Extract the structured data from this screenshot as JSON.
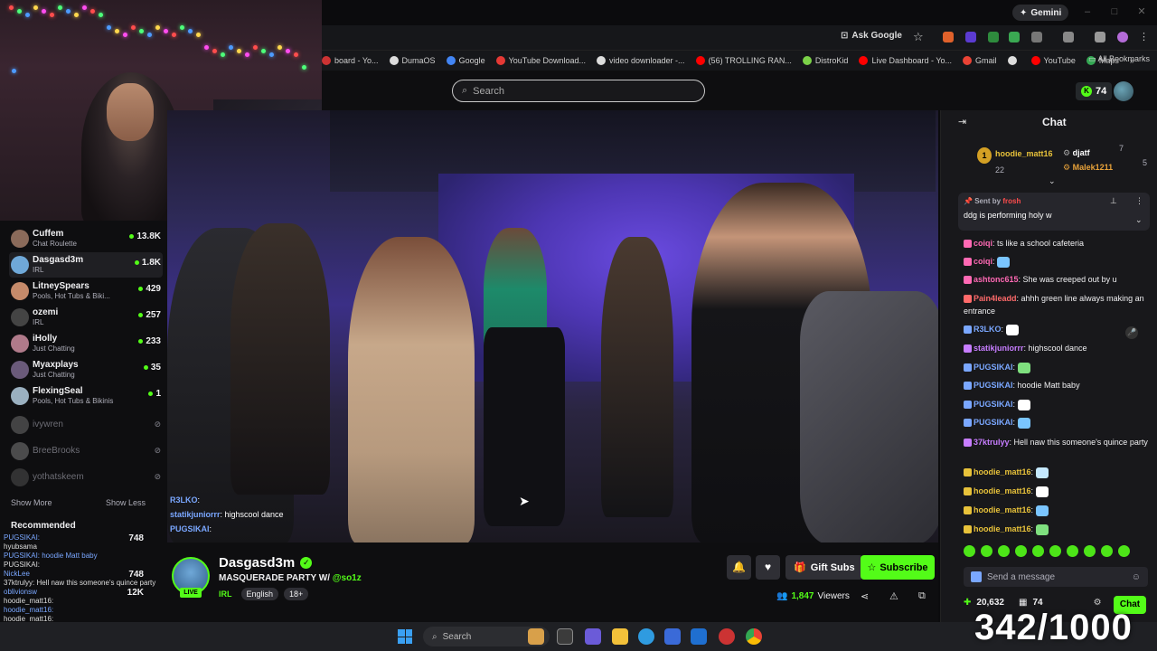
{
  "browser": {
    "gemini_label": "Gemini",
    "ask_google": "Ask Google",
    "bookmarks": [
      {
        "label": "board - Yo...",
        "color": "#cc3333"
      },
      {
        "label": "DumaOS",
        "color": "#dddddd"
      },
      {
        "label": "Google",
        "color": "#4285f4"
      },
      {
        "label": "YouTube Download...",
        "color": "#e53935"
      },
      {
        "label": "video downloader -...",
        "color": "#dddddd"
      },
      {
        "label": "(56) TROLLING RAN...",
        "color": "#ff0000"
      },
      {
        "label": "DistroKid",
        "color": "#7bd148"
      },
      {
        "label": "Live Dashboard - Yo...",
        "color": "#ff0000"
      },
      {
        "label": "Gmail",
        "color": "#ea4335"
      },
      {
        "label": "",
        "color": "#dddddd"
      },
      {
        "label": "YouTube",
        "color": "#ff0000"
      },
      {
        "label": "Maps",
        "color": "#34a853"
      }
    ],
    "all_bookmarks": "All Bookmarks"
  },
  "header": {
    "search_placeholder": "Search",
    "k_count": "74"
  },
  "sidebar": {
    "channels": [
      {
        "name": "Cuffem",
        "category": "Chat Roulette",
        "viewers": "13.8K",
        "color": "#8a6a5a"
      },
      {
        "name": "Dasgasd3m",
        "category": "IRL",
        "viewers": "1.8K",
        "color": "#6fa8d8"
      },
      {
        "name": "LitneySpears",
        "category": "Pools, Hot Tubs & Biki...",
        "viewers": "429",
        "color": "#c58a6a"
      },
      {
        "name": "ozemi",
        "category": "IRL",
        "viewers": "257",
        "color": "#444444"
      },
      {
        "name": "iHolly",
        "category": "Just Chatting",
        "viewers": "233",
        "color": "#b07a8a"
      },
      {
        "name": "Myaxplays",
        "category": "Just Chatting",
        "viewers": "35",
        "color": "#6a5a7a"
      },
      {
        "name": "FlexingSeal",
        "category": "Pools, Hot Tubs & Bikinis",
        "viewers": "1",
        "color": "#9ab0c0"
      }
    ],
    "offline": [
      {
        "name": "ivywren",
        "color": "#777777"
      },
      {
        "name": "BreeBrooks",
        "color": "#888888"
      },
      {
        "name": "yothatskeem",
        "color": "#555555"
      }
    ],
    "show_more": "Show More",
    "show_less": "Show Less",
    "recommended": "Recommended",
    "recommended_overlay": [
      {
        "text": "PUGSIKAI:",
        "value": "748"
      },
      {
        "text": "hyubsama",
        "value": ""
      },
      {
        "text": "PUGSIKAI: hoodie Matt baby",
        "value": ""
      },
      {
        "text": "PUGSIKAI:",
        "value": ""
      },
      {
        "text": "NickLee",
        "value": "748"
      },
      {
        "text": "37ktrulyy: Hell naw this someone's quince party",
        "value": ""
      },
      {
        "text": "oblivionsw",
        "value": "12K"
      },
      {
        "text": "hoodie_matt16:",
        "value": ""
      },
      {
        "text": "hoodie_matt16:",
        "value": ""
      },
      {
        "text": "hoodie_matt16:",
        "value": ""
      }
    ]
  },
  "video_overlay_chat": [
    {
      "user": "R3LKO",
      "text": ":"
    },
    {
      "user": "statikjuniorrr",
      "text": ": highscool dance"
    },
    {
      "user": "PUGSIKAI",
      "text": ":"
    }
  ],
  "stream": {
    "streamer": "Dasgasd3m",
    "live_label": "LIVE",
    "title": "MASQUERADE PARTY W/",
    "title_mention": "@so1z",
    "category": "IRL",
    "tags": [
      "English",
      "18+"
    ],
    "gift_subs": "Gift Subs",
    "subscribe": "Subscribe",
    "viewers_count": "1,847",
    "viewers_label": "Viewers"
  },
  "chat": {
    "title": "Chat",
    "leaderboard": [
      {
        "rank": "1",
        "name": "hoodie_matt16",
        "count": "22",
        "color": "#e8c23a"
      },
      {
        "name": "djatf",
        "count": "7",
        "color": "#ffffff"
      },
      {
        "name": "Malek1211",
        "count": "5",
        "color": "#e8a23a"
      }
    ],
    "pinned": {
      "sent_by": "Sent by",
      "sender": "frosh",
      "message": "ddg is performing holy w"
    },
    "messages": [
      {
        "user": "coiqi",
        "text": ": ts like a school cafeteria",
        "color": "#ff69b4"
      },
      {
        "user": "coiqi",
        "text": ":",
        "color": "#ff69b4"
      },
      {
        "user": "ashtonc615",
        "text": ": She was creeped out by u",
        "color": "#ff69b4"
      },
      {
        "user": "Pain4leadd",
        "text": ": ahhh green line always making an entrance",
        "color": "#ff6a6a"
      },
      {
        "user": "R3LKO",
        "text": ":",
        "color": "#7aa7ff"
      },
      {
        "user": "statikjuniorrr",
        "text": ": highscool dance",
        "color": "#c77dff"
      },
      {
        "user": "PUGSIKAI",
        "text": ":",
        "color": "#7aa7ff"
      },
      {
        "user": "PUGSIKAI",
        "text": ": hoodie Matt baby",
        "color": "#7aa7ff"
      },
      {
        "user": "PUGSIKAI",
        "text": ":",
        "color": "#7aa7ff"
      },
      {
        "user": "PUGSIKAI",
        "text": ":",
        "color": "#7aa7ff"
      },
      {
        "user": "37ktrulyy",
        "text": ": Hell naw this someone's quince party",
        "color": "#c77dff"
      },
      {
        "user": "hoodie_matt16",
        "text": ":",
        "color": "#e8c23a"
      },
      {
        "user": "hoodie_matt16",
        "text": ":",
        "color": "#e8c23a"
      },
      {
        "user": "hoodie_matt16",
        "text": ":",
        "color": "#e8c23a"
      },
      {
        "user": "hoodie_matt16",
        "text": ":",
        "color": "#e8c23a"
      }
    ],
    "input_placeholder": "Send a message",
    "points": "20,632",
    "other_count": "74",
    "chat_button": "Chat"
  },
  "taskbar": {
    "search_placeholder": "Search"
  },
  "counter": "342/1000",
  "colors": {
    "accent": "#53fc18",
    "background": "#0e0e10",
    "chat_bg": "#18181b"
  }
}
